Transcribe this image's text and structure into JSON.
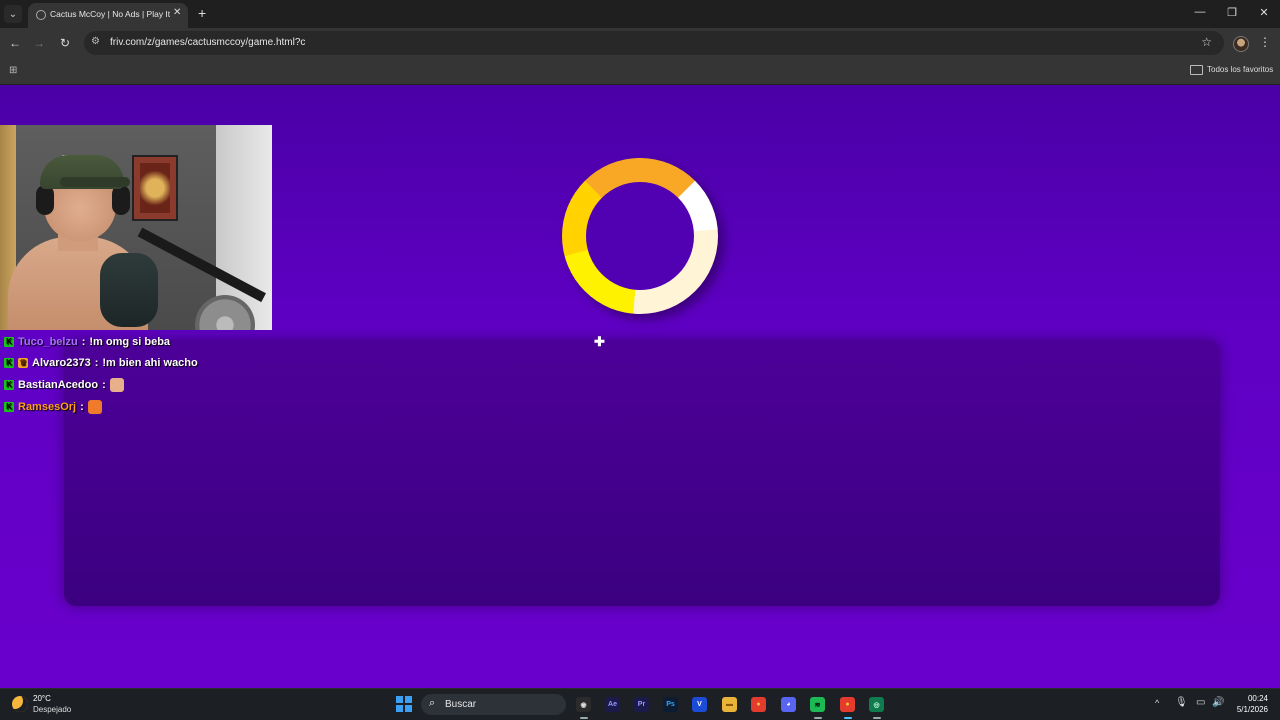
{
  "browser": {
    "tab_title": "Cactus McCoy | No Ads | Play It At",
    "tab_close": "✕",
    "new_tab": "+",
    "url": "friv.com/z/games/cactusmccoy/game.html?c",
    "bookmarks_folder": "Todos los favoritos",
    "window_controls": {
      "minimize": "—",
      "restore": "❐",
      "close": "✕"
    },
    "nav": {
      "back": "←",
      "forward": "→",
      "reload": "↻"
    },
    "star": "☆",
    "menu": "⋮",
    "apps": "⊞",
    "tab_list": "⌄"
  },
  "chat": [
    {
      "user": "Tuco_belzu",
      "user_color": "#a970ff",
      "sep": " :",
      "message": "!m omg si beba",
      "badges": [
        "k"
      ]
    },
    {
      "user": "Alvaro2373",
      "user_color": "#ffffff",
      "sep": " :",
      "message": "!m bien ahi wacho",
      "badges": [
        "k",
        "crown"
      ]
    },
    {
      "user": "BastianAcedoo",
      "user_color": "#ffffff",
      "sep": " :",
      "message": "",
      "badges": [
        "k"
      ],
      "emote_color": "#e7b08b"
    },
    {
      "user": "RamsesOrj",
      "user_color": "#ff9f1a",
      "sep": " :",
      "message": "",
      "badges": [
        "k"
      ],
      "emote_color": "#f07b2a"
    }
  ],
  "badge_glyphs": {
    "k": "K",
    "crown": "♛"
  },
  "page": {
    "cursor": "✚",
    "background_color": "#5f00c4",
    "loader_colors": [
      "#f9a825",
      "#ffffff",
      "#fff4d6",
      "#fff200"
    ]
  },
  "taskbar": {
    "temperature": "20°C",
    "weather": "Despejado",
    "search_placeholder": "Buscar",
    "search_icon": "⌕",
    "apps": [
      {
        "name": "obs",
        "glyph": "◉",
        "bg": "#2b2b2b",
        "fg": "#ddd"
      },
      {
        "name": "after-effects",
        "glyph": "Ae",
        "bg": "#1b1a4a",
        "fg": "#9999ff"
      },
      {
        "name": "premiere",
        "glyph": "Pr",
        "bg": "#1b1a4a",
        "fg": "#9999ff"
      },
      {
        "name": "photoshop",
        "glyph": "Ps",
        "bg": "#0c1d33",
        "fg": "#31a8ff"
      },
      {
        "name": "vegas",
        "glyph": "V",
        "bg": "#1c4bd8",
        "fg": "#fff"
      },
      {
        "name": "file-explorer",
        "glyph": "▬",
        "bg": "#e8b43a",
        "fg": "#8a5a00"
      },
      {
        "name": "chrome",
        "glyph": "●",
        "bg": "#e33b2e",
        "fg": "#fbc02d"
      },
      {
        "name": "discord",
        "glyph": "◕",
        "bg": "#5865f2",
        "fg": "#fff"
      },
      {
        "name": "spotify",
        "glyph": "≋",
        "bg": "#1db954",
        "fg": "#000"
      },
      {
        "name": "chrome-active",
        "glyph": "●",
        "bg": "#e33b2e",
        "fg": "#fbc02d"
      },
      {
        "name": "vpn",
        "glyph": "◎",
        "bg": "#0f7c4f",
        "fg": "#c8ffe0"
      }
    ],
    "tray_up": "^",
    "tray": [
      "🎙",
      "▭",
      "🔊"
    ],
    "time": "00:24",
    "date": "5/1/2026"
  }
}
